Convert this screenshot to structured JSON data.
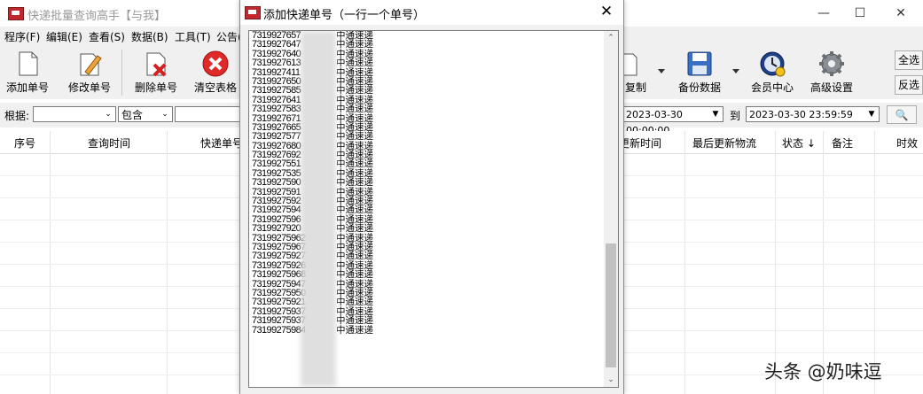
{
  "main": {
    "title": "快递批量查询高手【与我】",
    "menu": [
      "程序(F)",
      "编辑(E)",
      "查看(S)",
      "数据(B)",
      "工具(T)",
      "公告("
    ],
    "toolbar": {
      "add": "添加单号",
      "edit": "修改单号",
      "delete": "删除单号",
      "clear": "清空表格",
      "copy": "复制",
      "backup": "备份数据",
      "member": "会员中心",
      "advanced": "高级设置"
    },
    "side": {
      "select_all": "全选",
      "invert": "反选"
    },
    "filter": {
      "by_label": "根据:",
      "by_value": "",
      "op_value": "包含",
      "keyword": "",
      "date_from": "2023-03-30 00:00:00",
      "to_label": "到",
      "date_to": "2023-03-30 23:59:59"
    },
    "columns": [
      "序号",
      "查询时间",
      "快递单号",
      "更新时间",
      "最后更新物流",
      "状态 ↓",
      "备注",
      "时效"
    ]
  },
  "dialog": {
    "title": "添加快递单号（一行一个单号）",
    "close": "✕",
    "lines": [
      {
        "num": "7319927657",
        "carrier": "中通速递"
      },
      {
        "num": "7319927647",
        "carrier": "中通速递"
      },
      {
        "num": "7319927640",
        "carrier": "中通速递"
      },
      {
        "num": "7319927613",
        "carrier": "中通速递"
      },
      {
        "num": "7319927411",
        "carrier": "中通速递"
      },
      {
        "num": "7319927650",
        "carrier": "中通速递"
      },
      {
        "num": "7319927585",
        "carrier": "中通速递"
      },
      {
        "num": "7319927641",
        "carrier": "中通速递"
      },
      {
        "num": "7319927583",
        "carrier": "中通速递"
      },
      {
        "num": "7319927671",
        "carrier": "中通速递"
      },
      {
        "num": "7319927665",
        "carrier": "中通速递"
      },
      {
        "num": "7319927577",
        "carrier": "中通速递"
      },
      {
        "num": "7319927680",
        "carrier": "中通速递"
      },
      {
        "num": "7319927692",
        "carrier": "中通速递"
      },
      {
        "num": "7319927551",
        "carrier": "中通速递"
      },
      {
        "num": "7319927535",
        "carrier": "中通速递"
      },
      {
        "num": "7319927590",
        "carrier": "中通速递"
      },
      {
        "num": "7319927591",
        "carrier": "中通速递"
      },
      {
        "num": "7319927592",
        "carrier": "中通速递"
      },
      {
        "num": "7319927594",
        "carrier": "中通速递"
      },
      {
        "num": "7319927596",
        "carrier": "中通速递"
      },
      {
        "num": "7319927920",
        "carrier": "中通速递"
      },
      {
        "num": "73199275962",
        "carrier": "中通速递"
      },
      {
        "num": "73199275967",
        "carrier": "中通速递"
      },
      {
        "num": "73199275927",
        "carrier": "中通速递"
      },
      {
        "num": "73199275926",
        "carrier": "中通速递"
      },
      {
        "num": "73199275968",
        "carrier": "中通速递"
      },
      {
        "num": "73199275947",
        "carrier": "中通速递"
      },
      {
        "num": "73199275950",
        "carrier": "中通速递"
      },
      {
        "num": "73199275921",
        "carrier": "中通速递"
      },
      {
        "num": "73199275937",
        "carrier": "中通速递"
      },
      {
        "num": "73199275937",
        "carrier": "中通速递"
      },
      {
        "num": "73199275984",
        "carrier": "中通速递"
      }
    ]
  },
  "watermark": "头条 @奶味逗",
  "colors": {
    "accent_red": "#c0282d",
    "window_bg": "#f0f0f0"
  }
}
